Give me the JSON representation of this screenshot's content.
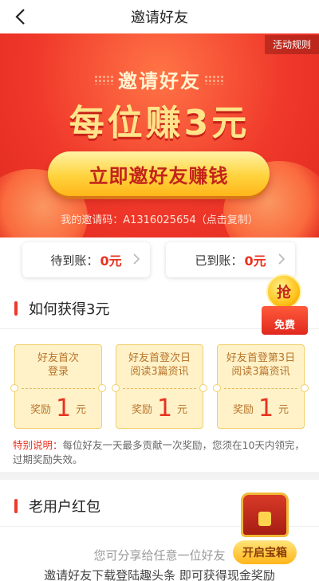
{
  "header": {
    "title": "邀请好友"
  },
  "banner": {
    "rules_label": "活动规则",
    "subtitle": "邀请好友",
    "headline": "每位赚3元",
    "cta_label": "立即邀好友赚钱",
    "invite_code_text": "我的邀请码：A1316025654（点击复制）"
  },
  "accounts": {
    "pending_label": "待到账：",
    "pending_value": "0元",
    "received_label": "已到账：",
    "received_value": "0元"
  },
  "grab_badge": {
    "coin_text": "抢",
    "label": "免费"
  },
  "how_to": {
    "title": "如何获得3元",
    "tasks": [
      {
        "line1": "好友首次",
        "line2": "登录",
        "reward_label": "奖励",
        "amount": "1",
        "unit": "元"
      },
      {
        "line1": "好友首登次日",
        "line2": "阅读3篇资讯",
        "reward_label": "奖励",
        "amount": "1",
        "unit": "元"
      },
      {
        "line1": "好友首登第3日",
        "line2": "阅读3篇资讯",
        "reward_label": "奖励",
        "amount": "1",
        "unit": "元"
      }
    ],
    "note_label": "特别说明：",
    "note_text": "每位好友一天最多贡献一次奖励，您须在10天内领完，过期奖励失效。"
  },
  "old_user": {
    "title": "老用户红包",
    "chest_button": "开启宝箱",
    "line1": "您可分享给任意一位好友",
    "line2": "邀请好友下载登陆趣头条 即可获得现金奖励"
  },
  "colors": {
    "accent": "#f0392b",
    "gold": "#ffd33d",
    "value_red": "#e8321f"
  }
}
